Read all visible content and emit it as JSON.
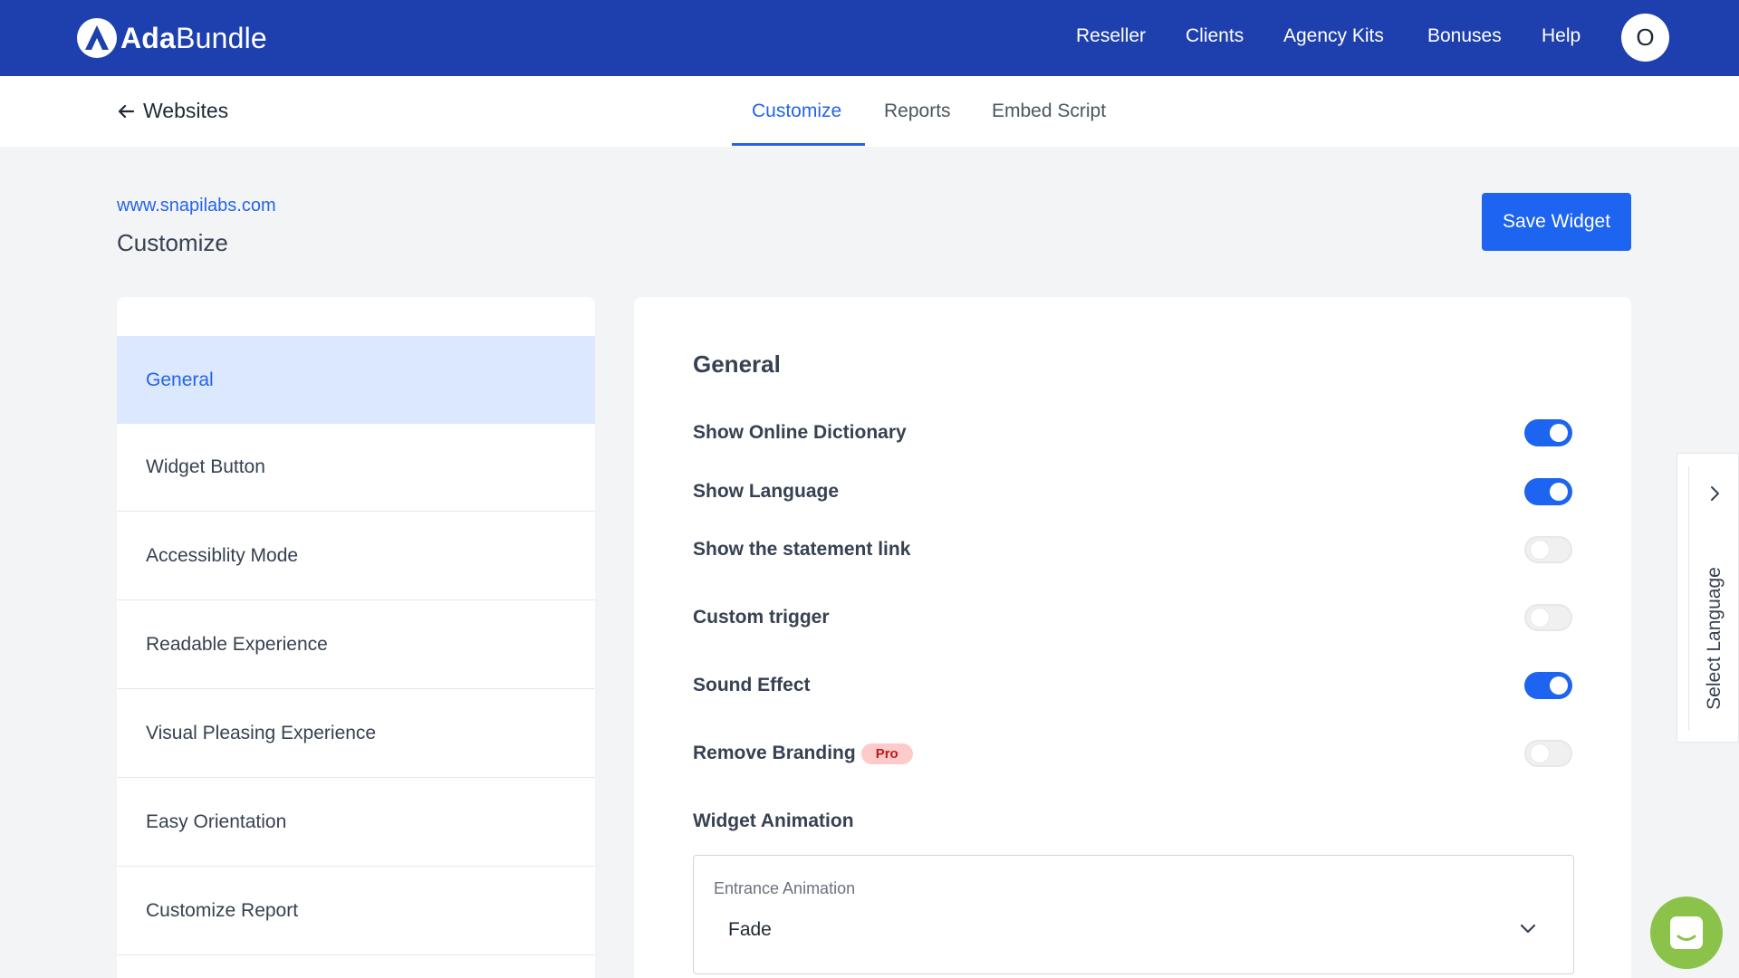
{
  "brand": {
    "name_bold": "Ada",
    "name_regular": "Bundle"
  },
  "nav": {
    "reseller": "Reseller",
    "clients": "Clients",
    "agency_kits": "Agency Kits",
    "bonuses": "Bonuses",
    "help": "Help",
    "avatar_initial": "O"
  },
  "subnav": {
    "back_label": "Websites",
    "tabs": [
      {
        "label": "Customize",
        "active": true
      },
      {
        "label": "Reports",
        "active": false
      },
      {
        "label": "Embed Script",
        "active": false
      }
    ]
  },
  "header": {
    "site_url": "www.snapilabs.com",
    "title": "Customize",
    "save_label": "Save Widget"
  },
  "sidebar": {
    "items": [
      {
        "label": "General",
        "active": true
      },
      {
        "label": "Widget Button"
      },
      {
        "label": "Accessiblity Mode"
      },
      {
        "label": "Readable Experience"
      },
      {
        "label": "Visual Pleasing Experience"
      },
      {
        "label": "Easy Orientation"
      },
      {
        "label": "Customize Report"
      }
    ]
  },
  "general": {
    "title": "General",
    "settings": [
      {
        "label": "Show Online Dictionary",
        "enabled": true
      },
      {
        "label": "Show Language",
        "enabled": true
      },
      {
        "label": "Show the statement link",
        "enabled": false
      },
      {
        "label": "Custom trigger",
        "enabled": false
      },
      {
        "label": "Sound Effect",
        "enabled": true
      },
      {
        "label": "Remove Branding",
        "enabled": false,
        "badge": "Pro"
      }
    ],
    "animation_heading": "Widget Animation",
    "entrance_caption": "Entrance Animation",
    "entrance_value": "Fade"
  },
  "language_drawer": {
    "label": "Select Language"
  },
  "colors": {
    "topbar": "#1e40af",
    "accent": "#1d64f0",
    "active_menu_bg": "#dbe8fd",
    "pro_badge_bg": "#fecaca",
    "chat_button": "#8bc34a"
  }
}
